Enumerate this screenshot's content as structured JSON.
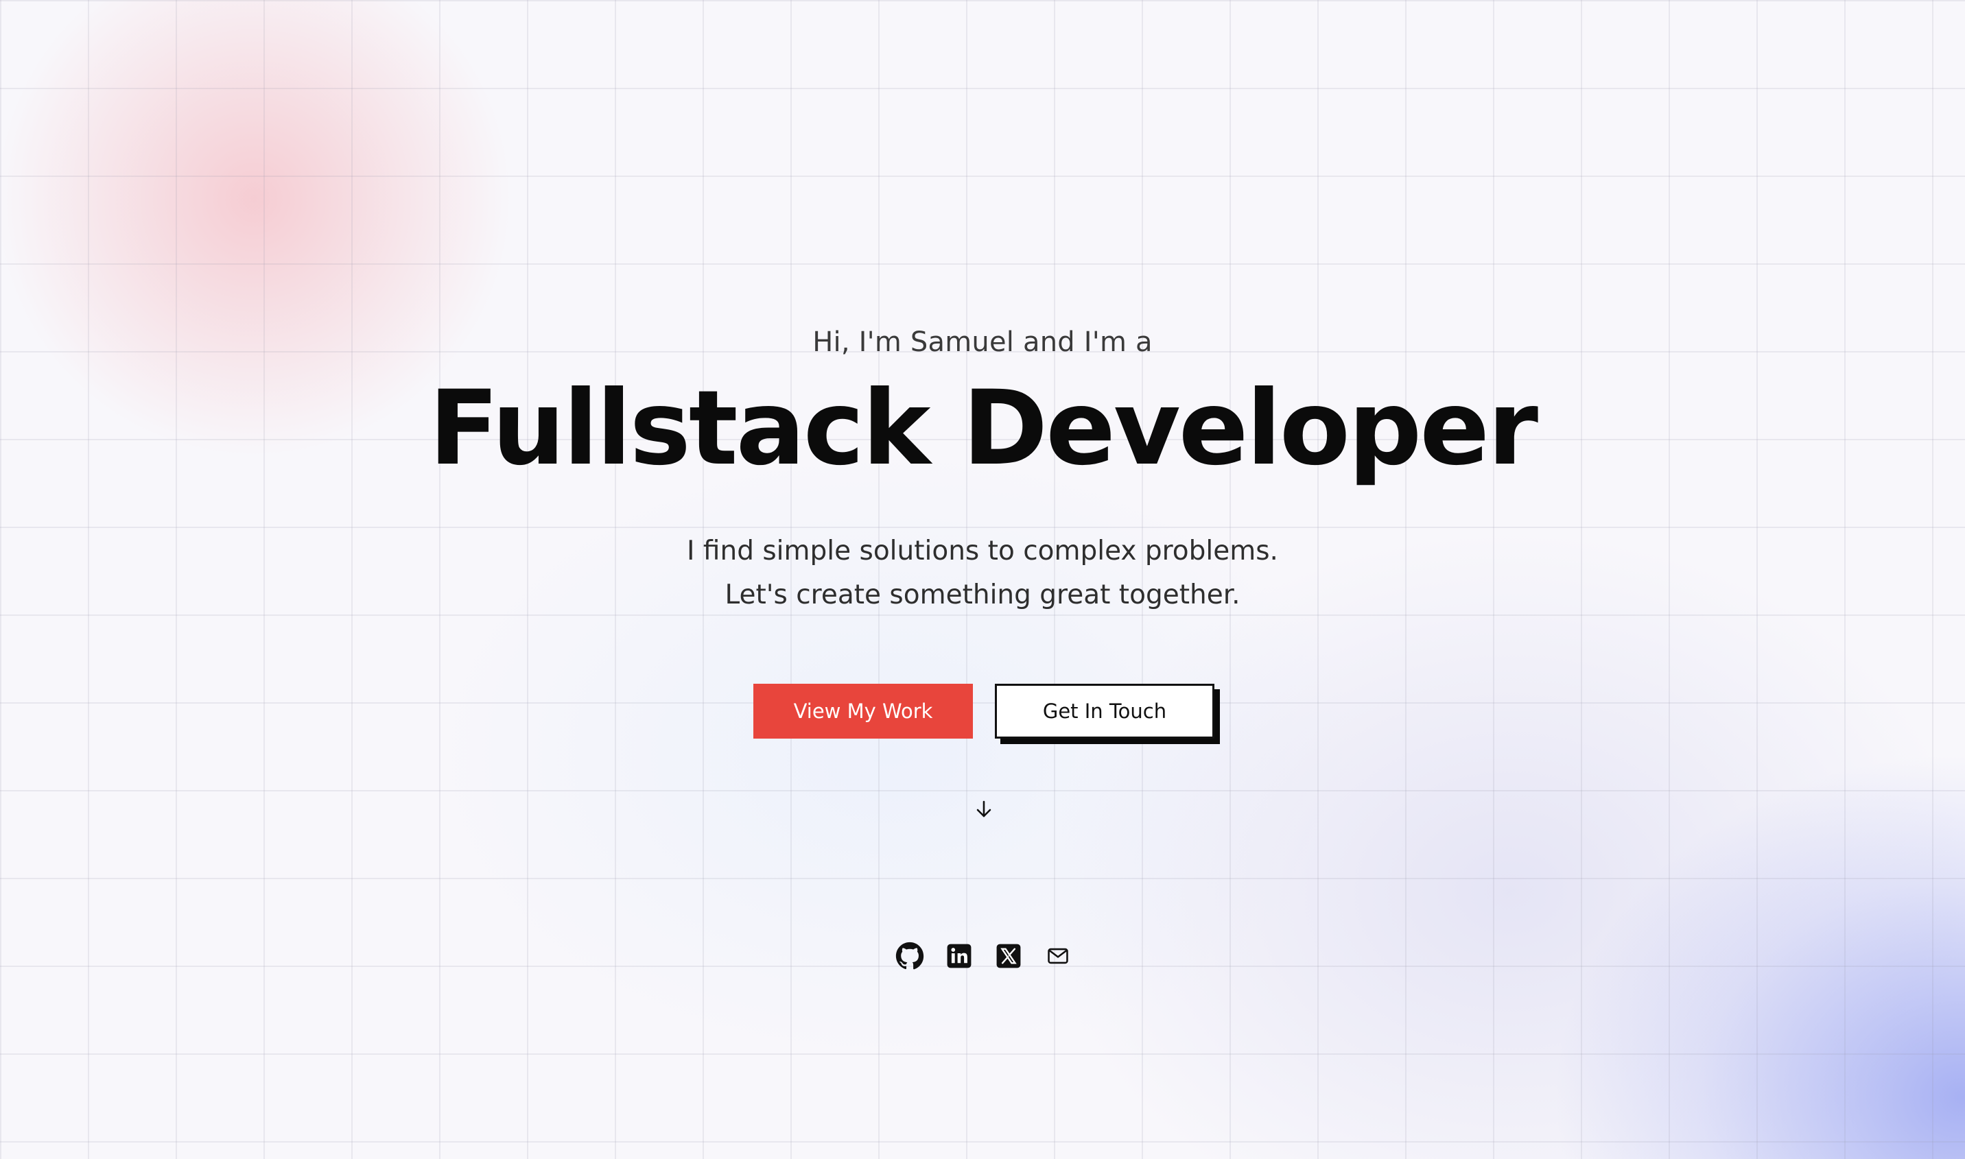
{
  "hero": {
    "greeting": "Hi, I'm Samuel and I'm a",
    "headline": "Fullstack Developer",
    "tagline_line1": "I find simple solutions to complex problems.",
    "tagline_line2": "Let's create something great together."
  },
  "actions": {
    "primary_label": "View My Work",
    "secondary_label": "Get In Touch"
  },
  "scroll_indicator": {
    "icon": "arrow-down-icon"
  },
  "socials": [
    {
      "icon": "github-icon"
    },
    {
      "icon": "linkedin-icon"
    },
    {
      "icon": "x-icon"
    },
    {
      "icon": "mail-icon"
    }
  ],
  "colors": {
    "accent": "#e8453c",
    "text": "#0b0b0b",
    "background": "#f8f7fb"
  }
}
